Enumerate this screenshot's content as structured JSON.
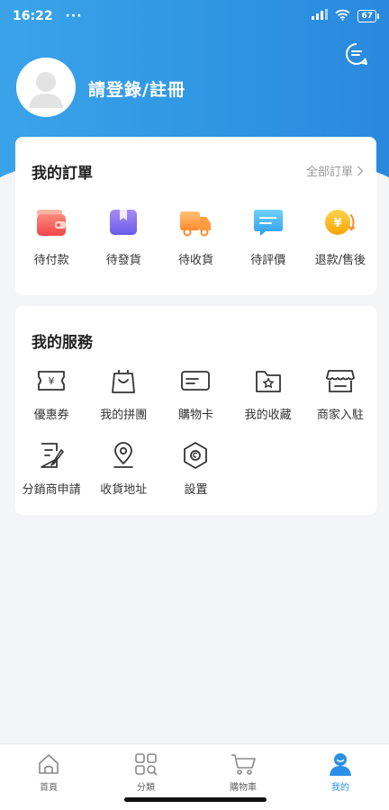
{
  "status_bar": {
    "time": "16:22",
    "dots": "···",
    "battery": "67"
  },
  "header": {
    "login_text": "請登錄/註冊"
  },
  "orders": {
    "title": "我的訂單",
    "all_label": "全部訂單",
    "items": [
      {
        "label": "待付款",
        "icon": "wallet-icon"
      },
      {
        "label": "待發貨",
        "icon": "package-icon"
      },
      {
        "label": "待收貨",
        "icon": "truck-icon"
      },
      {
        "label": "待評價",
        "icon": "comment-icon"
      },
      {
        "label": "退款/售後",
        "icon": "refund-coin-icon"
      }
    ]
  },
  "services": {
    "title": "我的服務",
    "items": [
      {
        "label": "優惠券",
        "icon": "coupon-icon"
      },
      {
        "label": "我的拼團",
        "icon": "shopping-bag-icon"
      },
      {
        "label": "購物卡",
        "icon": "card-icon"
      },
      {
        "label": "我的收藏",
        "icon": "star-folder-icon"
      },
      {
        "label": "商家入駐",
        "icon": "store-icon"
      },
      {
        "label": "分銷商申請",
        "icon": "application-form-icon"
      },
      {
        "label": "收貨地址",
        "icon": "location-pin-icon"
      },
      {
        "label": "設置",
        "icon": "settings-icon"
      }
    ]
  },
  "tabbar": {
    "items": [
      {
        "label": "首頁",
        "icon": "home-icon"
      },
      {
        "label": "分類",
        "icon": "category-icon"
      },
      {
        "label": "購物車",
        "icon": "cart-icon"
      },
      {
        "label": "我的",
        "icon": "profile-icon",
        "active": true
      }
    ]
  },
  "colors": {
    "brand": "#2f96e4",
    "active_tab": "#2a8fe6",
    "background": "#f4f5f7"
  }
}
